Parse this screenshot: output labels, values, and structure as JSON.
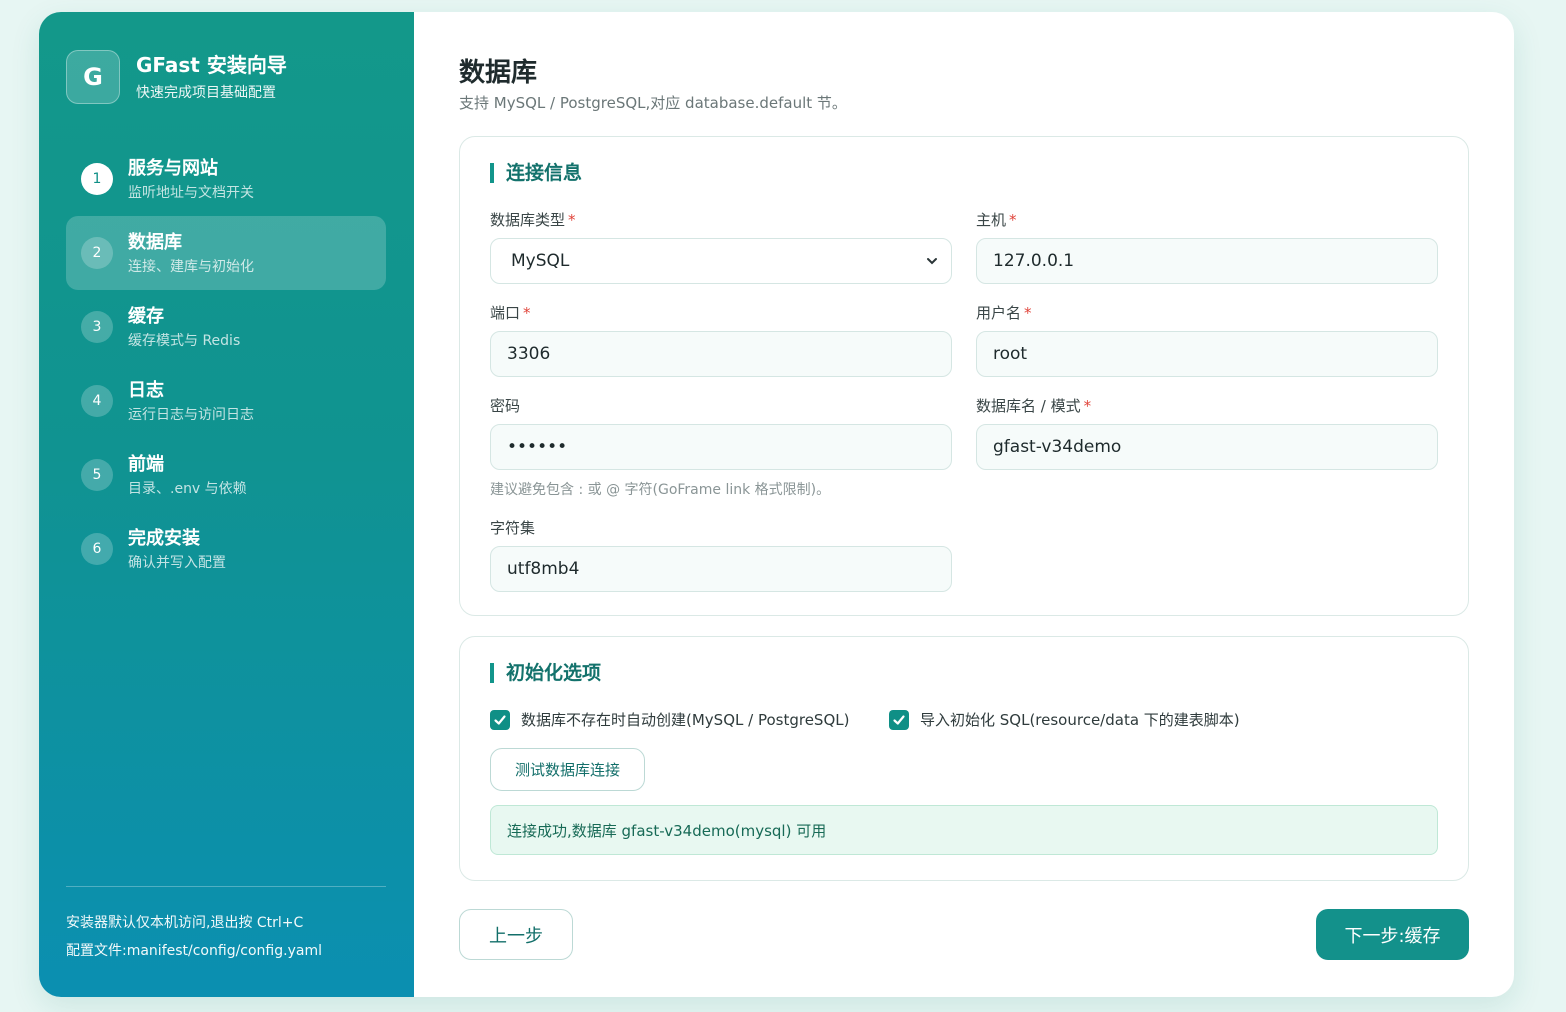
{
  "brand": {
    "logo": "G",
    "title": "GFast 安装向导",
    "subtitle": "快速完成项目基础配置"
  },
  "steps": [
    {
      "num": "1",
      "title": "服务与网站",
      "sub": "监听地址与文档开关"
    },
    {
      "num": "2",
      "title": "数据库",
      "sub": "连接、建库与初始化"
    },
    {
      "num": "3",
      "title": "缓存",
      "sub": "缓存模式与 Redis"
    },
    {
      "num": "4",
      "title": "日志",
      "sub": "运行日志与访问日志"
    },
    {
      "num": "5",
      "title": "前端",
      "sub": "目录、.env 与依赖"
    },
    {
      "num": "6",
      "title": "完成安装",
      "sub": "确认并写入配置"
    }
  ],
  "sidebar_footer": {
    "line1": "安装器默认仅本机访问,退出按 Ctrl+C",
    "line2": "配置文件:manifest/config/config.yaml"
  },
  "page": {
    "title": "数据库",
    "subtitle": "支持 MySQL / PostgreSQL,对应 database.default 节。"
  },
  "connection": {
    "title": "连接信息",
    "db_type": {
      "label": "数据库类型",
      "value": "MySQL"
    },
    "host": {
      "label": "主机",
      "value": "127.0.0.1"
    },
    "port": {
      "label": "端口",
      "value": "3306"
    },
    "user": {
      "label": "用户名",
      "value": "root"
    },
    "password": {
      "label": "密码",
      "value": "••••••"
    },
    "dbname": {
      "label": "数据库名 / 模式",
      "value": "gfast-v34demo"
    },
    "password_hint": "建议避免包含 : 或 @ 字符(GoFrame link 格式限制)。",
    "charset": {
      "label": "字符集",
      "value": "utf8mb4"
    },
    "required_mark": "*"
  },
  "init": {
    "title": "初始化选项",
    "auto_create": "数据库不存在时自动创建(MySQL / PostgreSQL)",
    "import_sql": "导入初始化 SQL(resource/data 下的建表脚本)",
    "test_button": "测试数据库连接",
    "success_message": "连接成功,数据库 gfast-v34demo(mysql) 可用"
  },
  "nav": {
    "prev": "上一步",
    "next": "下一步:缓存"
  },
  "icons": {
    "checkbox": "check-icon",
    "select": "chevron-down-icon"
  },
  "colors": {
    "accent": "#13918b",
    "success_bg": "#e8f8f1"
  }
}
